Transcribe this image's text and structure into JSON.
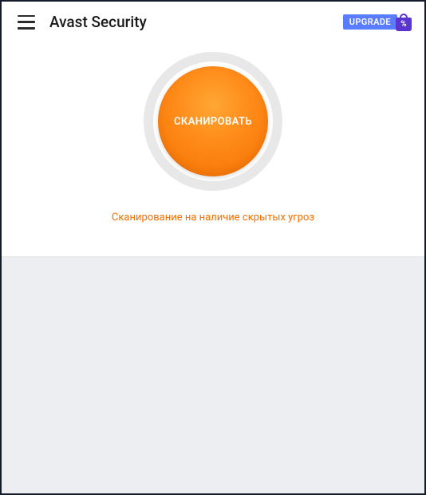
{
  "header": {
    "title": "Avast Security",
    "upgrade_label": "UPGRADE",
    "bag_symbol": "%"
  },
  "scan": {
    "button_label": "СКАНИРОВАТЬ",
    "caption": "Сканирование на наличие скрытых угроз"
  },
  "colors": {
    "accent": "#f46f00",
    "upgrade": "#5a7dff",
    "bag": "#5a35d0"
  }
}
